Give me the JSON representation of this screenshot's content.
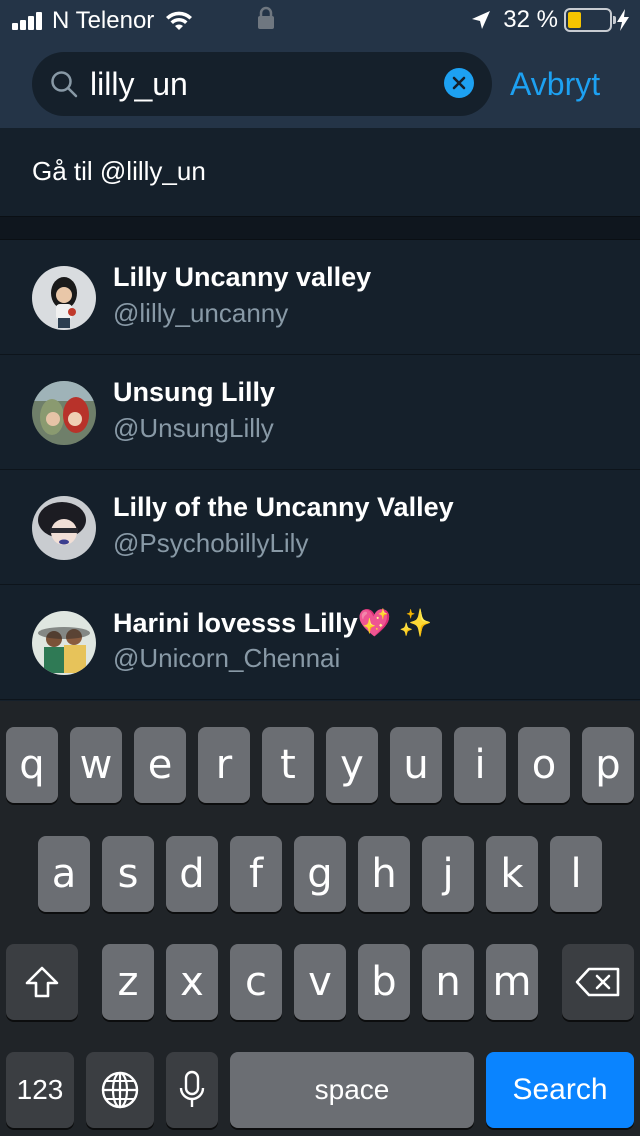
{
  "status_bar": {
    "carrier": "N Telenor",
    "battery_percent": "32 %",
    "battery_level": 0.32,
    "battery_color": "#f5c400"
  },
  "search": {
    "query": "lilly_un",
    "cancel_label": "Avbryt"
  },
  "goto": {
    "label": "Gå til @lilly_un"
  },
  "results": [
    {
      "name": "Lilly Uncanny valley",
      "handle": "@lilly_uncanny"
    },
    {
      "name": "Unsung Lilly",
      "handle": "@UnsungLilly"
    },
    {
      "name": "Lilly of the Uncanny Valley",
      "handle": "@PsychobillyLily"
    },
    {
      "name": "Harini lovesss Lilly💖 ✨",
      "handle": "@Unicorn_Chennai"
    }
  ],
  "keyboard": {
    "row1": [
      "q",
      "w",
      "e",
      "r",
      "t",
      "y",
      "u",
      "i",
      "o",
      "p"
    ],
    "row2": [
      "a",
      "s",
      "d",
      "f",
      "g",
      "h",
      "j",
      "k",
      "l"
    ],
    "row3": [
      "z",
      "x",
      "c",
      "v",
      "b",
      "n",
      "m"
    ],
    "numbers_label": "123",
    "space_label": "space",
    "search_label": "Search"
  },
  "colors": {
    "accent": "#1da1f2",
    "background": "#15202b",
    "header": "#243447",
    "secondary_text": "#8899a6",
    "search_key": "#0a84ff"
  }
}
